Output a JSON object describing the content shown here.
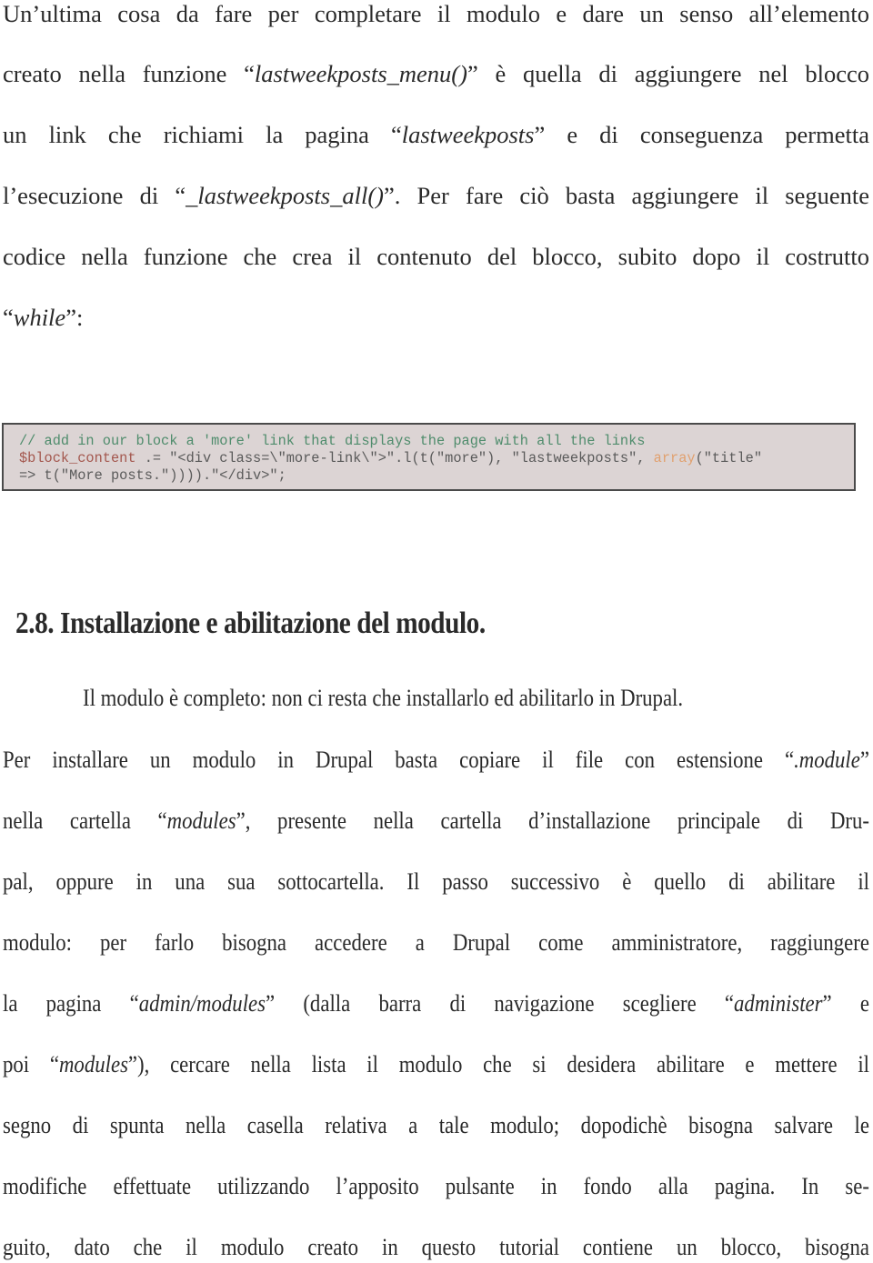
{
  "paragraph1": {
    "lines": [
      [
        "Un’ultima cosa da fare per completare il modulo e dare un senso all’elemento"
      ],
      [
        "creato nella funzione “",
        "lastweekposts_menu()",
        "” è quella di aggiungere nel blocco"
      ],
      [
        "un link che richiami la pagina “",
        "lastweekposts",
        "” e di conseguenza permetta"
      ],
      [
        "l’esecuzione di “",
        "_lastweekposts_all()",
        "”. Per fare ciò basta aggiungere il seguente"
      ],
      [
        "codice nella funzione che crea il contenuto del blocco, subito dopo il costrutto"
      ],
      [
        "“",
        "while",
        "”:"
      ]
    ]
  },
  "code_block": {
    "comment": "// add in our block a 'more' link that displays the page with all the links",
    "var": "$block_content",
    "line2_rest": " .= \"<div class=\\\"more-link\\\">\".l(t(\"more\"), \"lastweekposts\", ",
    "array_kw": "array",
    "line2_end": "(\"title\"",
    "line3": "=> t(\"More posts.\")))).\"</div>\";",
    "colors": {
      "background": "#dcd4d4",
      "comment": "#4f8c6c",
      "variable": "#a4584f",
      "keyword": "#e1a06e",
      "text": "#5a5a5a"
    }
  },
  "section": {
    "heading": "2.8. Installazione e abilitazione del modulo."
  },
  "paragraph2": {
    "lines": [
      [
        "Il modulo è completo: non ci resta che installarlo ed abilitarlo in Drupal."
      ],
      [
        "Per installare un modulo in Drupal basta copiare il file con estensione “",
        ".module",
        "”"
      ],
      [
        "nella cartella “",
        "modules",
        "”, presente nella cartella d’installazione principale di Dru-"
      ],
      [
        "pal, oppure in una sua sottocartella. Il passo successivo è quello di abilitare il"
      ],
      [
        "modulo: per farlo bisogna accedere a Drupal come amministratore, raggiungere"
      ],
      [
        "la pagina “",
        "admin/modules",
        "” (dalla barra di navigazione scegliere “",
        "administer",
        "” e"
      ],
      [
        "poi “",
        "modules",
        "”), cercare nella lista il modulo che si desidera abilitare e mettere il"
      ],
      [
        "segno di spunta nella casella relativa a tale modulo; dopodichè bisogna salvare le"
      ],
      [
        "modifiche effettuate utilizzando l’apposito pulsante in fondo alla pagina. In se-"
      ],
      [
        "guito, dato che il modulo creato in questo tutorial contiene un blocco, bisogna"
      ]
    ]
  }
}
